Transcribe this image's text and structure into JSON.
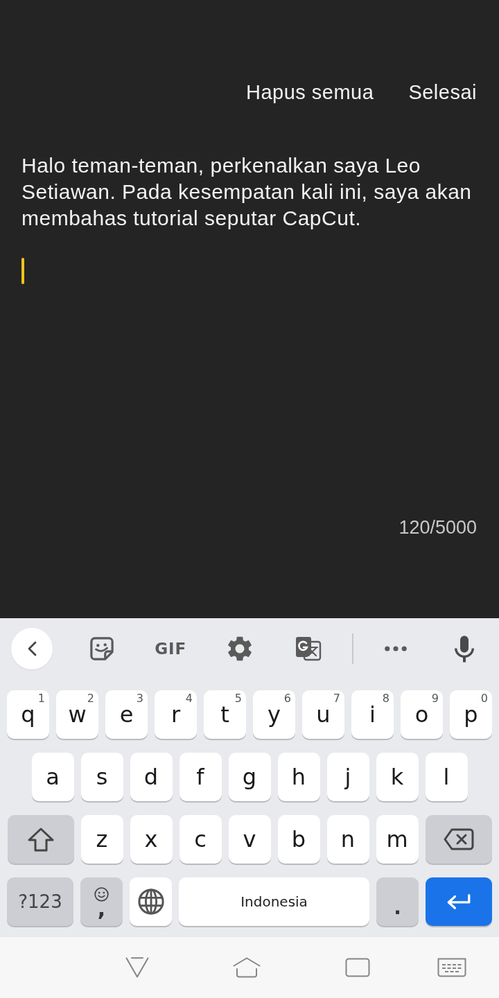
{
  "header": {
    "buttons": [
      "Hapus semua",
      "Selesai"
    ]
  },
  "editor": {
    "value": "Halo teman-teman, perkenalkan saya Leo Setiawan. Pada kesempatan kali ini, saya akan membahas tutorial seputar CapCut.",
    "focused": true,
    "character_count": "120/5000"
  },
  "keyboard": {
    "toolbar": {
      "start": [
        {
          "kind": "back"
        },
        {
          "kind": "sticker"
        },
        {
          "kind": "gif",
          "label": "GIF"
        },
        {
          "kind": "settings"
        },
        {
          "kind": "translate"
        }
      ],
      "end": [
        {
          "kind": "more"
        },
        {
          "kind": "mic"
        }
      ]
    },
    "rows": [
      {
        "keys": [
          {
            "kind": "letter",
            "label": "q",
            "hint": "1"
          },
          {
            "kind": "letter",
            "label": "w",
            "hint": "2"
          },
          {
            "kind": "letter",
            "label": "e",
            "hint": "3"
          },
          {
            "kind": "letter",
            "label": "r",
            "hint": "4"
          },
          {
            "kind": "letter",
            "label": "t",
            "hint": "5"
          },
          {
            "kind": "letter",
            "label": "y",
            "hint": "6"
          },
          {
            "kind": "letter",
            "label": "u",
            "hint": "7"
          },
          {
            "kind": "letter",
            "label": "i",
            "hint": "8"
          },
          {
            "kind": "letter",
            "label": "o",
            "hint": "9"
          },
          {
            "kind": "letter",
            "label": "p",
            "hint": "0"
          }
        ]
      },
      {
        "keys": [
          {
            "kind": "letter",
            "label": "a"
          },
          {
            "kind": "letter",
            "label": "s"
          },
          {
            "kind": "letter",
            "label": "d"
          },
          {
            "kind": "letter",
            "label": "f"
          },
          {
            "kind": "letter",
            "label": "g"
          },
          {
            "kind": "letter",
            "label": "h"
          },
          {
            "kind": "letter",
            "label": "j"
          },
          {
            "kind": "letter",
            "label": "k"
          },
          {
            "kind": "letter",
            "label": "l"
          }
        ]
      },
      {
        "keys": [
          {
            "kind": "shift"
          },
          {
            "kind": "letter",
            "label": "z"
          },
          {
            "kind": "letter",
            "label": "x"
          },
          {
            "kind": "letter",
            "label": "c"
          },
          {
            "kind": "letter",
            "label": "v"
          },
          {
            "kind": "letter",
            "label": "b"
          },
          {
            "kind": "letter",
            "label": "n"
          },
          {
            "kind": "letter",
            "label": "m"
          },
          {
            "kind": "backspace"
          }
        ]
      },
      {
        "keys": [
          {
            "kind": "symbols",
            "label": "?123"
          },
          {
            "kind": "emoji",
            "label": ","
          },
          {
            "kind": "globe"
          },
          {
            "kind": "space",
            "label": "Indonesia"
          },
          {
            "kind": "period",
            "label": "."
          },
          {
            "kind": "enter"
          }
        ]
      }
    ]
  }
}
